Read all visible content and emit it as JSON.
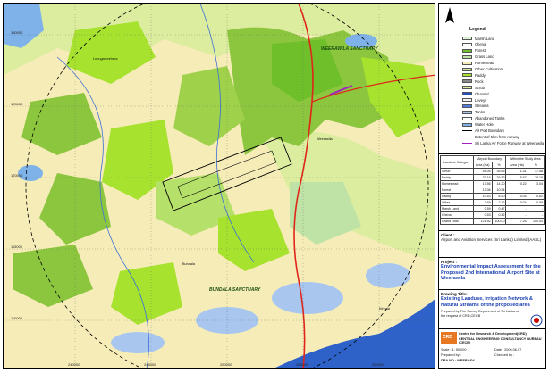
{
  "map": {
    "sanctuary_labels": [
      "WEERAWILA SANCTUARY",
      "BUNDALA SANCTUARY"
    ],
    "easting_ticks": [
      "240000",
      "245000",
      "250000",
      "255000",
      "260000"
    ],
    "northing_ticks": [
      "130000",
      "125000",
      "120000",
      "115000",
      "110000"
    ],
    "place_labels": [
      "Weerawila",
      "Kirinda",
      "Bundala",
      "Lunugamvehera"
    ],
    "colors": {
      "forest": "#8cc63f",
      "paddy": "#a6e22e",
      "scrub": "#dceda0",
      "homestead": "#f6ecb8",
      "other_cultivation": "#c9e39a",
      "water": "#7fb2e8",
      "sea": "#2f62c9",
      "tank": "#a9c7ee",
      "grass": "#bfe3a6",
      "road": "#e0261a",
      "stream": "#3a6fd8",
      "airport": "#000000"
    }
  },
  "legend": {
    "title": "Legend",
    "items": [
      {
        "label": "Marsh Land",
        "type": "fill",
        "color": "#d9eecf"
      },
      {
        "label": "Chena",
        "type": "fill",
        "color": "#ffffff"
      },
      {
        "label": "Forest",
        "type": "fill",
        "color": "#6fbf2b"
      },
      {
        "label": "Grass Land",
        "type": "fill",
        "color": "#bfe3a6"
      },
      {
        "label": "Homestead",
        "type": "fill",
        "color": "#f6ecb8"
      },
      {
        "label": "Other Cultivation",
        "type": "fill",
        "color": "#c9e39a"
      },
      {
        "label": "Paddy",
        "type": "fill",
        "color": "#a6e22e"
      },
      {
        "label": "Rock",
        "type": "fill",
        "color": "#8a8a8a"
      },
      {
        "label": "Scrub",
        "type": "fill",
        "color": "#dceda0"
      },
      {
        "label": "Channel",
        "type": "fill",
        "color": "#1f4fc0"
      },
      {
        "label": "Leveys",
        "type": "fill",
        "color": "#f3f3f3"
      },
      {
        "label": "Streams",
        "type": "fill",
        "color": "#4f7fe0"
      },
      {
        "label": "Tanks",
        "type": "fill",
        "color": "#a9c7ee"
      },
      {
        "label": "Abandoned Tanks",
        "type": "fill",
        "color": "#ffffff"
      },
      {
        "label": "Water Hole",
        "type": "fill",
        "color": "#7fb2e8"
      },
      {
        "label": "Air Port Boundary",
        "type": "line",
        "color": "#000000"
      },
      {
        "label": "Extent of 5km from runway",
        "type": "dash",
        "color": "#000000"
      },
      {
        "label": "Sri Lanka Air Force Runway at Weerawila",
        "type": "line",
        "color": "#a020c0"
      }
    ]
  },
  "landuse": {
    "group_headers": [
      "Landuse Category",
      "Airport Boundary",
      "Within the Study Area"
    ],
    "sub_headers": [
      "Area (Ha)",
      "%",
      "Area (Ha)",
      "%"
    ],
    "rows": [
      [
        "Scrub",
        "44.04",
        "35.65",
        "1.31",
        "17.58"
      ],
      [
        "Paddy",
        "33.16",
        "26.82",
        "5.67",
        "78.18"
      ],
      [
        "Homestead",
        "17.56",
        "14.20",
        "0.22",
        "3.04"
      ],
      [
        "Forest",
        "13.06",
        "10.54",
        "-",
        "-"
      ],
      [
        "Paddy",
        "10.53",
        "8.50",
        "0.04",
        "0.62"
      ],
      [
        "Other",
        "2.69",
        "2.12",
        "0.04",
        "0.58"
      ],
      [
        "Marsh Land",
        "0.59",
        "0.47",
        "-",
        "-"
      ],
      [
        "Chena",
        "0.53",
        "0.42",
        "-",
        "-"
      ],
      [
        "Grand Total",
        "121.92",
        "100.00",
        "7.24",
        "100.00"
      ]
    ]
  },
  "client": {
    "heading": "Client :",
    "text": "Airport and Aviation Services (Sri Lanka) Limited (AASL)"
  },
  "project": {
    "heading": "Project :",
    "text": "Environmental Impact Assessment for the Proposed 2nd International Airport Site at Weerawila"
  },
  "drawing": {
    "heading": "Drawing Title:",
    "text": "Existing Landuse, Irrigation Network & Natural Streams of the proposed area",
    "prepared": "Prepared by The Survey Department of Sri Lanka at the request of CRD,CECB"
  },
  "footer": {
    "org1": "Centre for Research & Development(CRD)",
    "org2": "CENTRAL ENGINEERING CONSULTANCY BUREAU (CECB)",
    "logo_text": "CRD",
    "scale": "Scale : 1: 50,000",
    "date": "Date : 2006.06.07",
    "prepared_by": "Prepared by :",
    "checked_by": "Checked by :",
    "dra_no": "DRA NO : WEERA/04"
  }
}
